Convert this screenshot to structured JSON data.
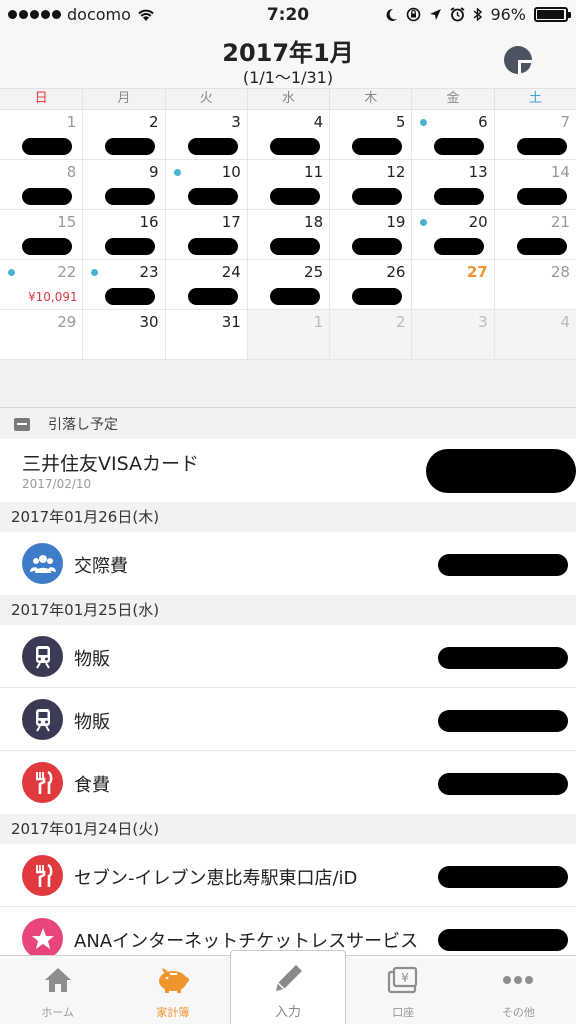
{
  "status_bar": {
    "carrier": "docomo",
    "time": "7:20",
    "battery": "96%",
    "icons": [
      "wifi-icon",
      "moon-icon",
      "rotation-lock-icon",
      "location-icon",
      "alarm-icon",
      "bluetooth-icon",
      "battery-icon"
    ]
  },
  "header": {
    "title": "2017年1月",
    "range": "(1/1〜1/31)",
    "pie_icon": "pie-chart-icon"
  },
  "calendar": {
    "weekdays": [
      "日",
      "月",
      "火",
      "水",
      "木",
      "金",
      "土"
    ],
    "weeks": [
      [
        {
          "n": "1",
          "blot": true
        },
        {
          "n": "2",
          "blot": true
        },
        {
          "n": "3",
          "blot": true
        },
        {
          "n": "4",
          "blot": true
        },
        {
          "n": "5",
          "blot": true
        },
        {
          "n": "6",
          "blot": true,
          "dot": true
        },
        {
          "n": "7",
          "blot": true
        }
      ],
      [
        {
          "n": "8",
          "blot": true
        },
        {
          "n": "9",
          "blot": true
        },
        {
          "n": "10",
          "blot": true,
          "dot": true
        },
        {
          "n": "11",
          "blot": true
        },
        {
          "n": "12",
          "blot": true
        },
        {
          "n": "13",
          "blot": true
        },
        {
          "n": "14",
          "blot": true
        }
      ],
      [
        {
          "n": "15",
          "blot": true
        },
        {
          "n": "16",
          "blot": true
        },
        {
          "n": "17",
          "blot": true
        },
        {
          "n": "18",
          "blot": true
        },
        {
          "n": "19",
          "blot": true
        },
        {
          "n": "20",
          "blot": true,
          "dot": true
        },
        {
          "n": "21",
          "blot": true
        }
      ],
      [
        {
          "n": "22",
          "dot": true,
          "amount": "¥10,091"
        },
        {
          "n": "23",
          "blot": true,
          "dot": true
        },
        {
          "n": "24",
          "blot": true
        },
        {
          "n": "25",
          "blot": true
        },
        {
          "n": "26",
          "blot": true
        },
        {
          "n": "27",
          "today": true
        },
        {
          "n": "28"
        }
      ],
      [
        {
          "n": "29"
        },
        {
          "n": "30"
        },
        {
          "n": "31"
        },
        {
          "n": "1",
          "other": true
        },
        {
          "n": "2",
          "other": true
        },
        {
          "n": "3",
          "other": true
        },
        {
          "n": "4",
          "other": true
        }
      ]
    ]
  },
  "withdrawal": {
    "header_label": "引落し予定",
    "name": "三井住友VISAカード",
    "date": "2017/02/10"
  },
  "transactions": [
    {
      "date": "2017年01月26日(木)",
      "items": [
        {
          "name": "交際費",
          "icon": "people-icon",
          "color": "#3d7cc9"
        }
      ]
    },
    {
      "date": "2017年01月25日(水)",
      "items": [
        {
          "name": "物販",
          "icon": "train-icon",
          "color": "#3a3a55"
        },
        {
          "name": "物販",
          "icon": "train-icon",
          "color": "#3a3a55"
        },
        {
          "name": "食費",
          "icon": "fork-knife-icon",
          "color": "#e0393e"
        }
      ]
    },
    {
      "date": "2017年01月24日(火)",
      "items": [
        {
          "name": "セブン-イレブン恵比寿駅東口店/iD",
          "icon": "fork-knife-icon",
          "color": "#e0393e"
        },
        {
          "name": "ANAインターネットチケットレスサービス",
          "icon": "star-icon",
          "color": "#e8457f"
        }
      ]
    }
  ],
  "tab_bar": {
    "tabs": [
      {
        "label": "ホーム",
        "icon": "home-icon"
      },
      {
        "label": "家計簿",
        "icon": "piggy-bank-icon",
        "active": true
      },
      {
        "label": "入力",
        "icon": "pencil-icon"
      },
      {
        "label": "口座",
        "icon": "yen-wallet-icon"
      },
      {
        "label": "その他",
        "icon": "more-dots-icon"
      }
    ],
    "active_color": "#f0952d"
  }
}
